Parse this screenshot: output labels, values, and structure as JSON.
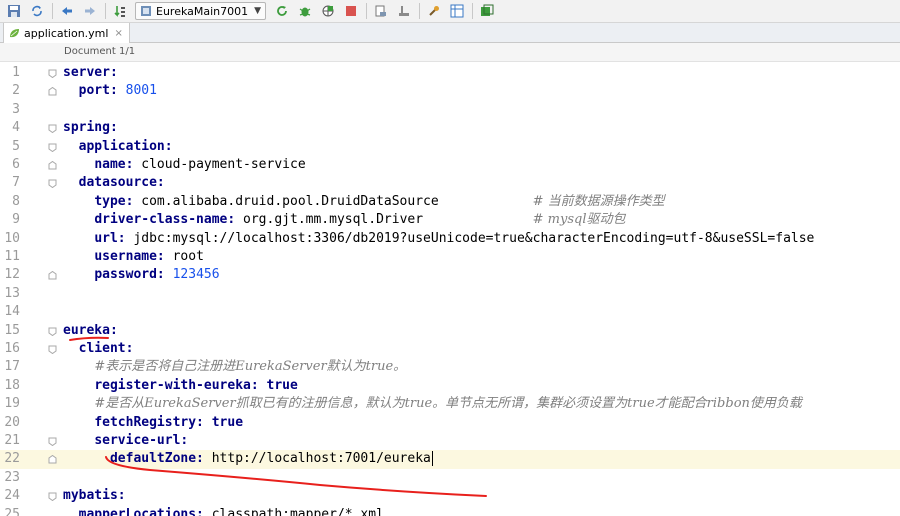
{
  "toolbar": {
    "run_config": "EurekaMain7001",
    "icons": [
      "save-icon",
      "sync-icon",
      "back-icon",
      "forward-icon",
      "build-icon",
      "run-config-icon",
      "rerun-icon",
      "debug-icon",
      "coverage-icon",
      "stop-icon",
      "build-artifact-icon",
      "sdk-icon",
      "wrench-icon",
      "structure-icon",
      "maven-icon"
    ]
  },
  "tab": {
    "label": "application.yml",
    "close": "×"
  },
  "doc": {
    "label": "Document 1/1"
  },
  "editor": {
    "current_line": 22,
    "lines": [
      {
        "n": "1",
        "segs": [
          {
            "t": "server:",
            "c": "k"
          }
        ]
      },
      {
        "n": "2",
        "segs": [
          {
            "t": "  "
          },
          {
            "t": "port:",
            "c": "k"
          },
          {
            "t": " "
          },
          {
            "t": "8001",
            "c": "v"
          }
        ]
      },
      {
        "n": "3",
        "segs": []
      },
      {
        "n": "4",
        "segs": [
          {
            "t": "spring:",
            "c": "k"
          }
        ]
      },
      {
        "n": "5",
        "segs": [
          {
            "t": "  "
          },
          {
            "t": "application:",
            "c": "k"
          }
        ]
      },
      {
        "n": "6",
        "segs": [
          {
            "t": "    "
          },
          {
            "t": "name:",
            "c": "k"
          },
          {
            "t": " cloud-payment-service"
          }
        ]
      },
      {
        "n": "7",
        "segs": [
          {
            "t": "  "
          },
          {
            "t": "datasource:",
            "c": "k"
          }
        ]
      },
      {
        "n": "8",
        "segs": [
          {
            "t": "    "
          },
          {
            "t": "type:",
            "c": "k"
          },
          {
            "t": " com.alibaba.druid.pool.DruidDataSource            "
          },
          {
            "t": "# 当前数据源操作类型",
            "c": "c"
          }
        ]
      },
      {
        "n": "9",
        "segs": [
          {
            "t": "    "
          },
          {
            "t": "driver-class-name:",
            "c": "k"
          },
          {
            "t": " org.gjt.mm.mysql.Driver              "
          },
          {
            "t": "# mysql驱动包",
            "c": "c"
          }
        ]
      },
      {
        "n": "10",
        "segs": [
          {
            "t": "    "
          },
          {
            "t": "url:",
            "c": "k"
          },
          {
            "t": " jdbc:mysql://localhost:3306/db2019?useUnicode=true&characterEncoding=utf-8&useSSL=false"
          }
        ]
      },
      {
        "n": "11",
        "segs": [
          {
            "t": "    "
          },
          {
            "t": "username:",
            "c": "k"
          },
          {
            "t": " root"
          }
        ]
      },
      {
        "n": "12",
        "segs": [
          {
            "t": "    "
          },
          {
            "t": "password:",
            "c": "k"
          },
          {
            "t": " "
          },
          {
            "t": "123456",
            "c": "v"
          }
        ]
      },
      {
        "n": "13",
        "segs": []
      },
      {
        "n": "14",
        "segs": []
      },
      {
        "n": "15",
        "segs": [
          {
            "t": "eureka:",
            "c": "k"
          }
        ]
      },
      {
        "n": "16",
        "segs": [
          {
            "t": "  "
          },
          {
            "t": "client:",
            "c": "k"
          }
        ]
      },
      {
        "n": "17",
        "segs": [
          {
            "t": "    "
          },
          {
            "t": "#表示是否将自己注册进EurekaServer默认为true。",
            "c": "c"
          }
        ]
      },
      {
        "n": "18",
        "segs": [
          {
            "t": "    "
          },
          {
            "t": "register-with-eureka:",
            "c": "k"
          },
          {
            "t": " "
          },
          {
            "t": "true",
            "c": "k"
          }
        ]
      },
      {
        "n": "19",
        "segs": [
          {
            "t": "    "
          },
          {
            "t": "#是否从EurekaServer抓取已有的注册信息，默认为true。单节点无所谓，集群必须设置为true才能配合ribbon使用负载",
            "c": "c"
          }
        ]
      },
      {
        "n": "20",
        "segs": [
          {
            "t": "    "
          },
          {
            "t": "fetchRegistry:",
            "c": "k"
          },
          {
            "t": " "
          },
          {
            "t": "true",
            "c": "k"
          }
        ]
      },
      {
        "n": "21",
        "segs": [
          {
            "t": "    "
          },
          {
            "t": "service-url:",
            "c": "k"
          }
        ]
      },
      {
        "n": "22",
        "segs": [
          {
            "t": "      "
          },
          {
            "t": "defaultZone:",
            "c": "k"
          },
          {
            "t": " http://localhost:7001/eureka"
          }
        ]
      },
      {
        "n": "23",
        "segs": []
      },
      {
        "n": "24",
        "segs": [
          {
            "t": "mybatis:",
            "c": "k"
          }
        ]
      },
      {
        "n": "25",
        "segs": [
          {
            "t": "  "
          },
          {
            "t": "mapperLocations:",
            "c": "k"
          },
          {
            "t": " classpath:mapper/*.xml"
          }
        ]
      }
    ]
  },
  "annotation": {
    "color": "#e8201c"
  }
}
